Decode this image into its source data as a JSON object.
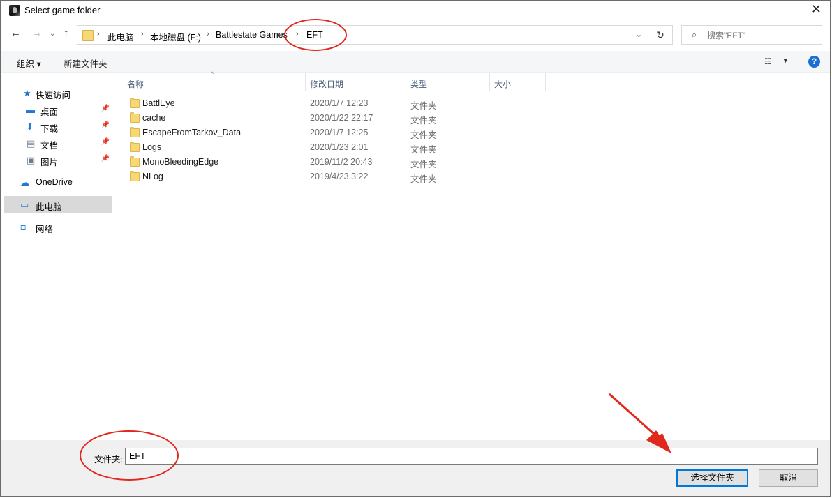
{
  "window": {
    "title": "Select game folder",
    "close_glyph": "✕"
  },
  "nav": {
    "back_glyph": "←",
    "forward_glyph": "→",
    "dropdown_glyph": "⌄",
    "up_glyph": "↑",
    "breadcrumbs": [
      "此电脑",
      "本地磁盘 (F:)",
      "Battlestate Games",
      "EFT"
    ],
    "separator": "›",
    "address_dropdown_glyph": "⌄",
    "refresh_glyph": "↻",
    "search_placeholder": "搜索\"EFT\"",
    "search_glyph": "⌕"
  },
  "toolbar": {
    "organize": "组织 ▾",
    "new_folder": "新建文件夹",
    "view_glyph": "☷",
    "view_dd": "▼",
    "help_glyph": "?"
  },
  "sidebar": {
    "items": [
      {
        "label": "快速访问",
        "icon": "star-icon",
        "glyph": "★",
        "color": "#1f6fc5"
      },
      {
        "label": "桌面",
        "icon": "desktop-icon",
        "glyph": "▬",
        "color": "#1f78d1",
        "pinned": true
      },
      {
        "label": "下载",
        "icon": "download-icon",
        "glyph": "⬇",
        "color": "#1f78d1",
        "pinned": true
      },
      {
        "label": "文档",
        "icon": "document-icon",
        "glyph": "▤",
        "color": "#6b7b8c",
        "pinned": true
      },
      {
        "label": "图片",
        "icon": "picture-icon",
        "glyph": "▣",
        "color": "#6b7b8c",
        "pinned": true
      },
      {
        "label": "OneDrive",
        "icon": "cloud-icon",
        "glyph": "☁",
        "color": "#1f78d1"
      },
      {
        "label": "此电脑",
        "icon": "computer-icon",
        "glyph": "▭",
        "color": "#2b88d8"
      },
      {
        "label": "网络",
        "icon": "network-icon",
        "glyph": "⧈",
        "color": "#2b88d8"
      }
    ],
    "pin_glyph": "📌"
  },
  "columns": {
    "name": "名称",
    "date": "修改日期",
    "type": "类型",
    "size": "大小",
    "sort_glyph": "^"
  },
  "files": [
    {
      "name": "BattlEye",
      "date": "2020/1/7 12:23",
      "type": "文件夹"
    },
    {
      "name": "cache",
      "date": "2020/1/22 22:17",
      "type": "文件夹"
    },
    {
      "name": "EscapeFromTarkov_Data",
      "date": "2020/1/7 12:25",
      "type": "文件夹"
    },
    {
      "name": "Logs",
      "date": "2020/1/23 2:01",
      "type": "文件夹"
    },
    {
      "name": "MonoBleedingEdge",
      "date": "2019/11/2 20:43",
      "type": "文件夹"
    },
    {
      "name": "NLog",
      "date": "2019/4/23 3:22",
      "type": "文件夹"
    }
  ],
  "bottom": {
    "folder_label": "文件夹:",
    "folder_value": "EFT",
    "select_button": "选择文件夹",
    "cancel_button": "取消"
  },
  "colors": {
    "annotation": "#e0281c",
    "accent": "#0078d7"
  }
}
